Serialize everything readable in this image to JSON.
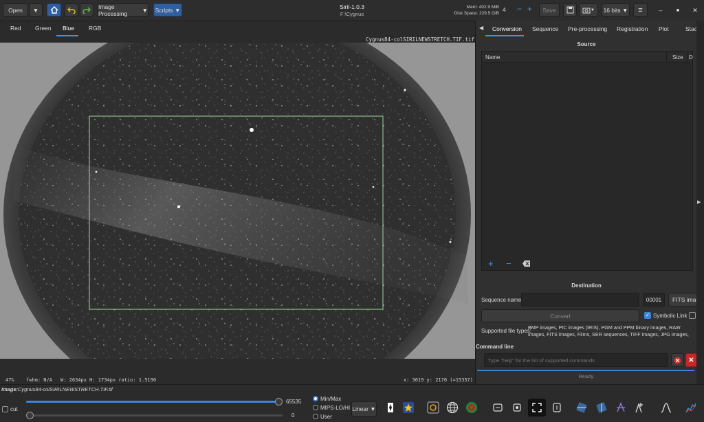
{
  "header": {
    "open_label": "Open",
    "image_processing_label": "Image Processing",
    "scripts_label": "Scripts",
    "app_title": "Siril-1.0.3",
    "working_dir": "F:\\Cygnus",
    "mem": "Mem: 402.9 MiB",
    "disk": "Disk Space: 229.5 GiB",
    "threads": "4",
    "save_label": "Save",
    "bits_label": "16 bits"
  },
  "channels": [
    "Red",
    "Green",
    "Blue",
    "RGB"
  ],
  "image": {
    "filename": "Cygnus84-colSIRILNEWSTRETCH.TIF.tif"
  },
  "status": {
    "zoom": "47%",
    "fwhm": "fwhm: N/A",
    "dims": "W: 2634px H: 1734px ratio: 1.5190",
    "coords": "x: 3619 y: 2170 (=15357)"
  },
  "right_tabs": [
    "Conversion",
    "Sequence",
    "Pre-processing",
    "Registration",
    "Plot",
    "Stack"
  ],
  "conversion": {
    "source_title": "Source",
    "col_name": "Name",
    "col_size": "Size",
    "col_date": "D",
    "destination_title": "Destination",
    "sequence_name_label": "Sequence name:",
    "start_index": "00001",
    "format_label": "FITS image",
    "convert_label": "Convert",
    "symbolic_link_label": "Symbolic Link",
    "supported_label": "Supported file types:",
    "supported_text": "BMP images, PIC images (IRIS), PGM and PPM binary images, RAW images, FITS images, Films, SER sequences, TIFF images, JPG images, PNG images, HEIF images"
  },
  "command": {
    "title": "Command line",
    "placeholder": "Type \"help\" for the list of supported commands",
    "status": "Ready."
  },
  "bottom": {
    "image_label": "Image:",
    "image_name": "Cygnus84-colSIRILNEWSTRETCH.TIF.tif",
    "cut_label": "cut",
    "high_value": "65535",
    "low_value": "0",
    "high_fraction": 1.0,
    "low_fraction": 0.0,
    "scale_options": [
      "Min/Max",
      "MIPS-LO/HI",
      "User"
    ],
    "scale_selected": "Min/Max",
    "stretch_label": "Linear"
  },
  "colors": {
    "accent": "#3d85d8",
    "selection": "#9fd49f",
    "close_red": "#c62828"
  }
}
